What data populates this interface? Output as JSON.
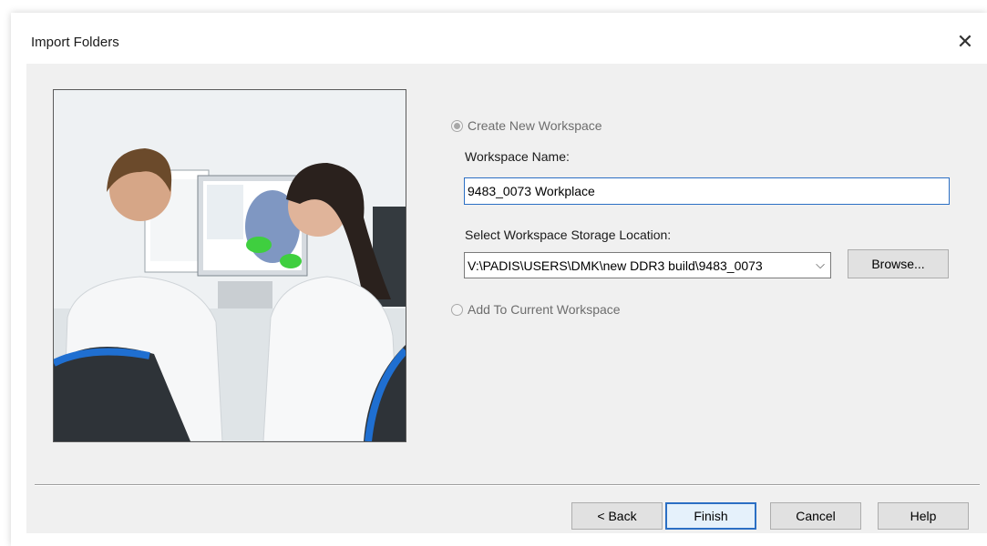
{
  "window": {
    "title": "Import Folders",
    "close_icon": "close-icon",
    "close_glyph": "✕"
  },
  "illustration": {
    "description_icon": "lab-photo"
  },
  "options": {
    "create_new": {
      "label": "Create New Workspace",
      "checked": true,
      "enabled": false
    },
    "workspace_name": {
      "label": "Workspace Name:",
      "value": "9483_0073 Workplace"
    },
    "storage_location": {
      "label": "Select Workspace Storage Location:",
      "value": "V:\\PADIS\\USERS\\DMK\\new DDR3 build\\9483_0073",
      "arrow_glyph": "⌵"
    },
    "browse_label": "Browse...",
    "add_to_current": {
      "label": "Add To Current Workspace",
      "checked": false,
      "enabled": false
    }
  },
  "footer": {
    "back_label": "< Back",
    "finish_label": "Finish",
    "cancel_label": "Cancel",
    "help_label": "Help"
  },
  "colors": {
    "accent": "#2b6fc4",
    "panel": "#f0f0f0",
    "disabled_text": "#6d6d6d"
  }
}
